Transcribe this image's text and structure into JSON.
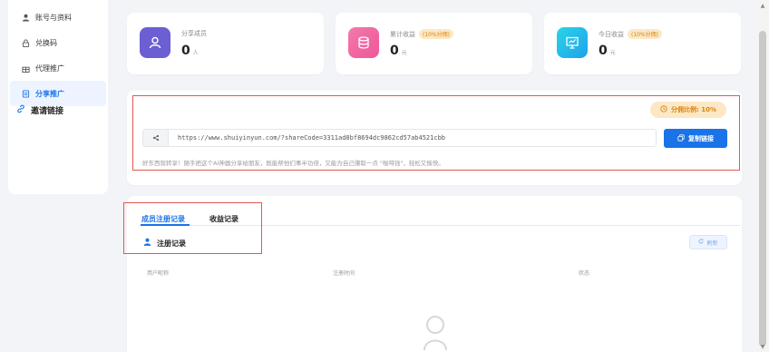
{
  "sidebar": {
    "items": [
      {
        "label": "账号与资料",
        "icon": "user-icon"
      },
      {
        "label": "兑换码",
        "icon": "lock-icon"
      },
      {
        "label": "代理推广",
        "icon": "gift-icon"
      },
      {
        "label": "分享推广",
        "icon": "document-icon",
        "active": true
      }
    ]
  },
  "stats": [
    {
      "label": "分享成员",
      "value": "0",
      "unit": "人",
      "tag": "",
      "icon": "user-icon",
      "color": "#6b5fd3"
    },
    {
      "label": "累计收益",
      "value": "0",
      "unit": "元",
      "tag": "(10%分佣)",
      "icon": "database-icon",
      "color": "#f06aa4"
    },
    {
      "label": "今日收益",
      "value": "0",
      "unit": "元",
      "tag": "(10%分佣)",
      "icon": "presentation-icon",
      "color": "#23b8e8"
    }
  ],
  "invite": {
    "title": "邀请链接",
    "ratio": "分佣比例: 10%",
    "url": "https://www.shuiyinyun.com/?shareCode=3311ad8bf8694dc9862cd57ab4521cbb",
    "copy_label": "复制链接",
    "tip": "好东西就转享！随手把这个AI神器分享给朋友，既能帮他们事半功倍，又能为自己赚取一点 \"咖啡钱\"，轻松又愉快。"
  },
  "records": {
    "tabs": [
      "成员注册记录",
      "收益记录"
    ],
    "subtitle": "注册记录",
    "refresh_label": "刷新",
    "columns": [
      "用户昵称",
      "注册时间",
      "状态"
    ]
  },
  "colors": {
    "accent": "#1a73e8",
    "highlight": "#e05a4f"
  }
}
